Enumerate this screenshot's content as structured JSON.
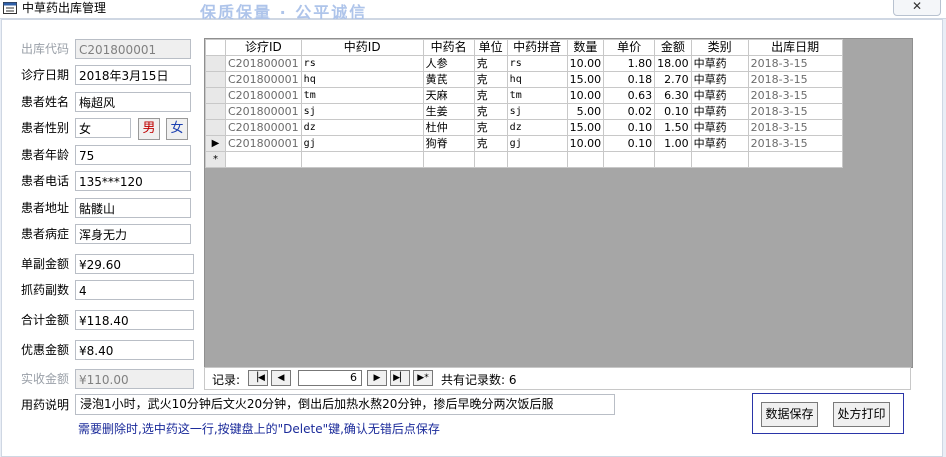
{
  "window": {
    "title": "中草药出库管理",
    "watermark": "保质保量 · 公平诚信",
    "close_glyph": "✕"
  },
  "form": {
    "outbound_code": {
      "label": "出库代码",
      "value": "C201800001"
    },
    "visit_date": {
      "label": "诊疗日期",
      "value": "2018年3月15日"
    },
    "patient_name": {
      "label": "患者姓名",
      "value": "梅超风"
    },
    "patient_gender": {
      "label": "患者性别",
      "value": "女",
      "male_label": "男",
      "female_label": "女"
    },
    "patient_age": {
      "label": "患者年龄",
      "value": "75"
    },
    "patient_phone": {
      "label": "患者电话",
      "value": "135***120"
    },
    "patient_address": {
      "label": "患者地址",
      "value": "骷髅山"
    },
    "patient_condition": {
      "label": "患者病症",
      "value": "浑身无力"
    },
    "per_dose_amount": {
      "label": "单副金额",
      "value": "¥29.60"
    },
    "dose_count": {
      "label": "抓药副数",
      "value": "4"
    },
    "total_amount": {
      "label": "合计金额",
      "value": "¥118.40"
    },
    "discount_amount": {
      "label": "优惠金额",
      "value": "¥8.40"
    },
    "actual_amount": {
      "label": "实收金额",
      "value": "¥110.00"
    },
    "usage": {
      "label": "用药说明",
      "value": "浸泡1小时，武火10分钟后文火20分钟，倒出后加热水熬20分钟，掺后早晚分两次饭后服"
    }
  },
  "grid": {
    "columns": [
      "诊疗ID",
      "中药ID",
      "中药名",
      "单位",
      "中药拼音",
      "数量",
      "单价",
      "金额",
      "类别",
      "出库日期"
    ],
    "rows": [
      [
        "C201800001",
        "rs",
        "人参",
        "克",
        "rs",
        "10.00",
        "1.80",
        "18.00",
        "中草药",
        "2018-3-15"
      ],
      [
        "C201800001",
        "hq",
        "黄芪",
        "克",
        "hq",
        "15.00",
        "0.18",
        "2.70",
        "中草药",
        "2018-3-15"
      ],
      [
        "C201800001",
        "tm",
        "天麻",
        "克",
        "tm",
        "10.00",
        "0.63",
        "6.30",
        "中草药",
        "2018-3-15"
      ],
      [
        "C201800001",
        "sj",
        "生姜",
        "克",
        "sj",
        "5.00",
        "0.02",
        "0.10",
        "中草药",
        "2018-3-15"
      ],
      [
        "C201800001",
        "dz",
        "杜仲",
        "克",
        "dz",
        "15.00",
        "0.10",
        "1.50",
        "中草药",
        "2018-3-15"
      ],
      [
        "C201800001",
        "gj",
        "狗脊",
        "克",
        "gj",
        "10.00",
        "0.10",
        "1.00",
        "中草药",
        "2018-3-15"
      ]
    ],
    "current_marker": "▶",
    "new_marker": "*"
  },
  "navigator": {
    "label": "记录:",
    "first_glyph": "▕◀",
    "prev_glyph": "◀",
    "next_glyph": "▶",
    "last_glyph": "▶▏",
    "new_glyph": "▶*",
    "current": "6",
    "total_label": "共有记录数: 6"
  },
  "hint": "需要删除时,选中药这一行,按键盘上的\"Delete\"键,确认无错后点保存",
  "actions": {
    "save_label": "数据保存",
    "print_label": "处方打印"
  },
  "colors": {
    "hint_text": "#1a2a9a",
    "action_border": "#2a35a8",
    "male_text": "#c00000",
    "female_text": "#1b3fb0",
    "grid_background": "#a6a6a6"
  }
}
